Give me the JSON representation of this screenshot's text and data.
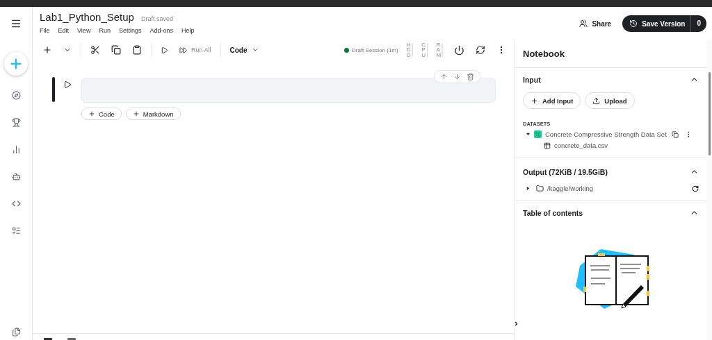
{
  "notebook": {
    "title": "Lab1_Python_Setup",
    "save_status": "Draft saved"
  },
  "menu": [
    "File",
    "Edit",
    "View",
    "Run",
    "Settings",
    "Add-ons",
    "Help"
  ],
  "header_actions": {
    "share": "Share",
    "save_version": "Save Version",
    "version_count": "0"
  },
  "toolbar": {
    "run_all": "Run All",
    "cell_type": "Code",
    "session": {
      "label": "Draft Session (1m)",
      "active": true
    },
    "meters": [
      "HDD",
      "CPU",
      "RAM"
    ]
  },
  "cell": {
    "selected": true
  },
  "add_cell_buttons": [
    "Code",
    "Markdown"
  ],
  "panel": {
    "title": "Notebook",
    "input": {
      "title": "Input",
      "expanded": true,
      "buttons": [
        {
          "kind": "add",
          "label": "Add Input"
        },
        {
          "kind": "upload",
          "label": "Upload"
        }
      ],
      "datasets_heading": "DATASETS",
      "datasets": [
        {
          "name": "Concrete Compressive Strength Data Set",
          "expanded": true,
          "files": [
            "concrete_data.csv"
          ]
        }
      ]
    },
    "output": {
      "title": "Output (72KiB / 19.5GiB)",
      "expanded": true,
      "folders": [
        {
          "path": "/kaggle/working",
          "expanded": false
        }
      ]
    },
    "toc": {
      "title": "Table of contents",
      "expanded": true
    }
  }
}
